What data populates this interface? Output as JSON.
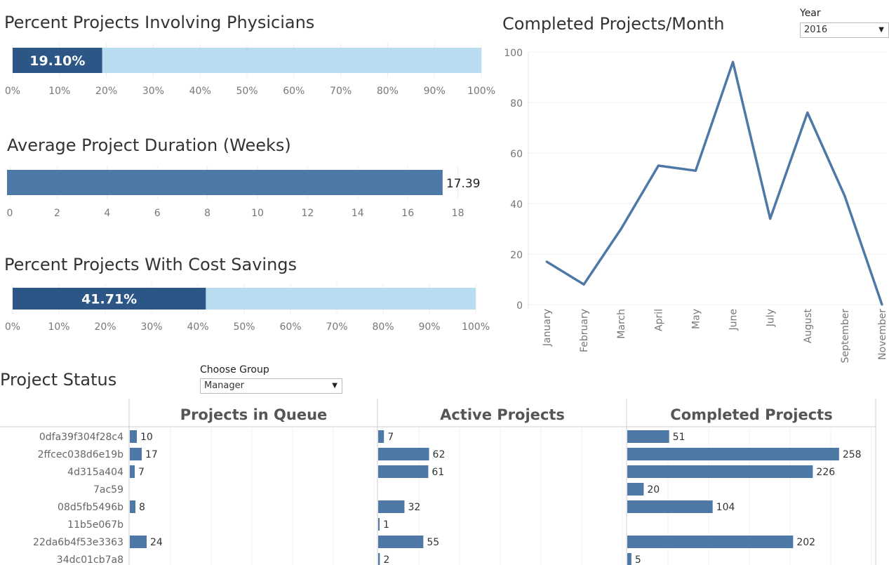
{
  "physicians": {
    "title": "Percent Projects Involving Physicians",
    "value": 19.1,
    "value_label": "19.10%",
    "ticks": [
      "0%",
      "10%",
      "20%",
      "30%",
      "40%",
      "50%",
      "60%",
      "70%",
      "80%",
      "90%",
      "100%"
    ]
  },
  "duration": {
    "title": "Average Project Duration (Weeks)",
    "value": 17.39,
    "value_label": "17.39",
    "ticks": [
      "0",
      "2",
      "4",
      "6",
      "8",
      "10",
      "12",
      "14",
      "16",
      "18"
    ]
  },
  "cost_savings": {
    "title": "Percent Projects With Cost Savings",
    "value": 41.71,
    "value_label": "41.71%",
    "ticks": [
      "0%",
      "10%",
      "20%",
      "30%",
      "40%",
      "50%",
      "60%",
      "70%",
      "80%",
      "90%",
      "100%"
    ]
  },
  "year_filter": {
    "label": "Year",
    "value": "2016"
  },
  "group_filter": {
    "label": "Choose Group",
    "value": "Manager"
  },
  "status_title": "Project Status",
  "colors": {
    "dark": "#2c5686",
    "light": "#b9dcf0",
    "mid": "#4e79a7",
    "grid": "#ececec"
  },
  "chart_data": [
    {
      "type": "line",
      "title": "Completed Projects/Month",
      "x": [
        "January",
        "February",
        "March",
        "April",
        "May",
        "June",
        "July",
        "August",
        "September",
        "November"
      ],
      "y": [
        17,
        8,
        30,
        55,
        53,
        96,
        34,
        76,
        43,
        0
      ],
      "ylim": [
        0,
        100
      ],
      "yticks": [
        0,
        20,
        40,
        60,
        80,
        100
      ]
    },
    {
      "type": "bar",
      "orientation": "horizontal",
      "categories": [
        "0dfa39f304f28c4",
        "2ffcec038d6e19b",
        "4d315a404",
        "7ac59",
        "08d5fb5496b",
        "11b5e067b",
        "22da6b4f53e3363",
        "34dc01cb7a8"
      ],
      "panels": [
        {
          "name": "Projects in Queue",
          "values": [
            10,
            17,
            7,
            null,
            8,
            null,
            24,
            null
          ]
        },
        {
          "name": "Active Projects",
          "values": [
            7,
            62,
            61,
            null,
            32,
            1,
            55,
            2
          ]
        },
        {
          "name": "Completed Projects",
          "values": [
            51,
            258,
            226,
            20,
            104,
            null,
            202,
            5
          ]
        }
      ]
    }
  ]
}
